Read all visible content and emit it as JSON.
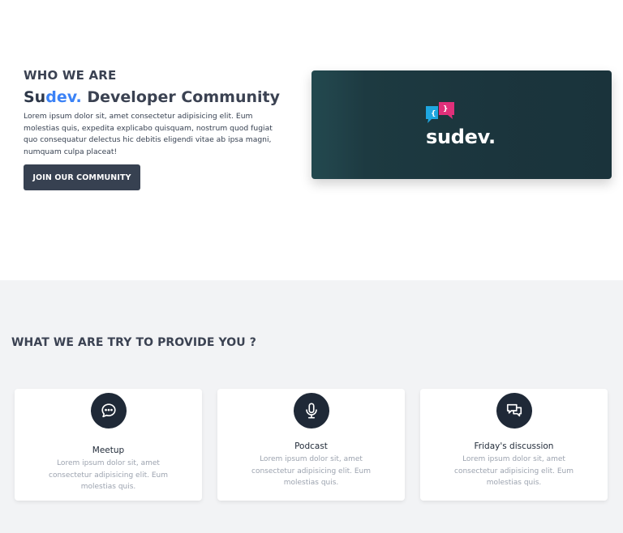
{
  "hero": {
    "eyebrow": "WHO WE ARE",
    "brand_prefix": "Su",
    "brand_accent": "dev.",
    "headline_rest": " Developer Community",
    "lead": "Lorem ipsum dolor sit, amet consectetur adipisicing elit. Eum molestias quis, expedita explicabo quisquam, nostrum quod fugiat quo consequatur delectus hic debitis eligendi vitae ab ipsa magni, numquam culpa placeat!",
    "join_label": "JOIN OUR COMMUNITY",
    "logo_text": "sudev.",
    "logo_icon": "chat-bubbles-logo-icon"
  },
  "features": {
    "title": "WHAT WE ARE TRY TO PROVIDE YOU ?",
    "cards": [
      {
        "title": "Meetup",
        "text": "Lorem ipsum dolor sit, amet consectetur adipisicing elit. Eum molestias quis.",
        "icon": "chat-bubble-icon"
      },
      {
        "title": "Podcast",
        "text": "Lorem ipsum dolor sit, amet consectetur adipisicing elit. Eum molestias quis.",
        "icon": "microphone-icon"
      },
      {
        "title": "Friday's discussion",
        "text": "Lorem ipsum dolor sit, amet consectetur adipisicing elit. Eum molestias quis.",
        "icon": "discussion-icon"
      }
    ]
  },
  "colors": {
    "accent": "#3b82f6",
    "dark": "#374151",
    "banner": "#1b353d",
    "logo_blue": "#1ea6e0",
    "logo_pink": "#e0307a"
  }
}
